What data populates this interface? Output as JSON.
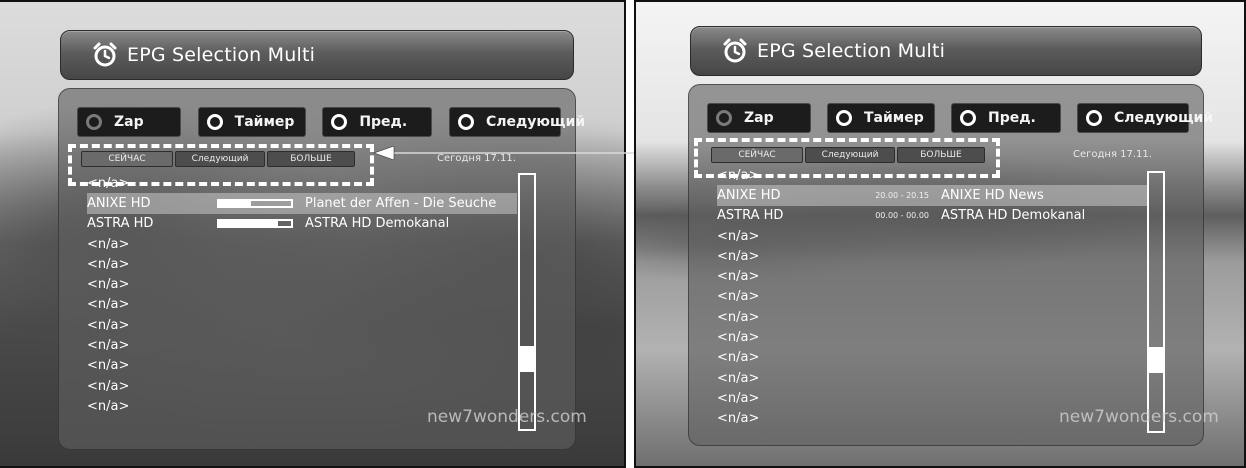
{
  "header": {
    "title": "EPG Selection Multi",
    "icon": "alarm-clock-icon"
  },
  "buttons": [
    {
      "label": "Zap",
      "indicator": "dim"
    },
    {
      "label": "Таймер",
      "indicator": "white"
    },
    {
      "label": "Пред.",
      "indicator": "white"
    },
    {
      "label": "Следующий",
      "indicator": "white"
    }
  ],
  "tabs": [
    "СЕЙЧАС",
    "Следующий",
    "БОЛЬШЕ"
  ],
  "date_label": "Сегодня 17.11.",
  "left": {
    "rows": [
      {
        "channel": "<n/a>",
        "program": "",
        "progress": null
      },
      {
        "channel": "ANIXE HD",
        "program": "Planet der Affen - Die Seuche",
        "progress": 0.45,
        "selected": true
      },
      {
        "channel": "ASTRA HD",
        "program": "ASTRA HD Demokanal",
        "progress": 0.82
      },
      {
        "channel": "<n/a>"
      },
      {
        "channel": "<n/a>"
      },
      {
        "channel": "<n/a>"
      },
      {
        "channel": "<n/a>"
      },
      {
        "channel": "<n/a>"
      },
      {
        "channel": "<n/a>"
      },
      {
        "channel": "<n/a>"
      },
      {
        "channel": "<n/a>"
      },
      {
        "channel": "<n/a>"
      }
    ],
    "watermark": "new7wonders.com"
  },
  "right": {
    "rows": [
      {
        "channel": "<n/a>",
        "time": "",
        "program": ""
      },
      {
        "channel": "ANIXE HD",
        "time": "20.00 - 20.15",
        "program": "ANIXE HD News",
        "selected": true
      },
      {
        "channel": "ASTRA HD",
        "time": "00.00 - 00.00",
        "program": "ASTRA HD Demokanal"
      },
      {
        "channel": "<n/a>"
      },
      {
        "channel": "<n/a>"
      },
      {
        "channel": "<n/a>"
      },
      {
        "channel": "<n/a>"
      },
      {
        "channel": "<n/a>"
      },
      {
        "channel": "<n/a>"
      },
      {
        "channel": "<n/a>"
      },
      {
        "channel": "<n/a>"
      },
      {
        "channel": "<n/a>"
      },
      {
        "channel": "<n/a>"
      }
    ],
    "watermark": "new7wonders.com"
  },
  "scroll_position": 0.75
}
